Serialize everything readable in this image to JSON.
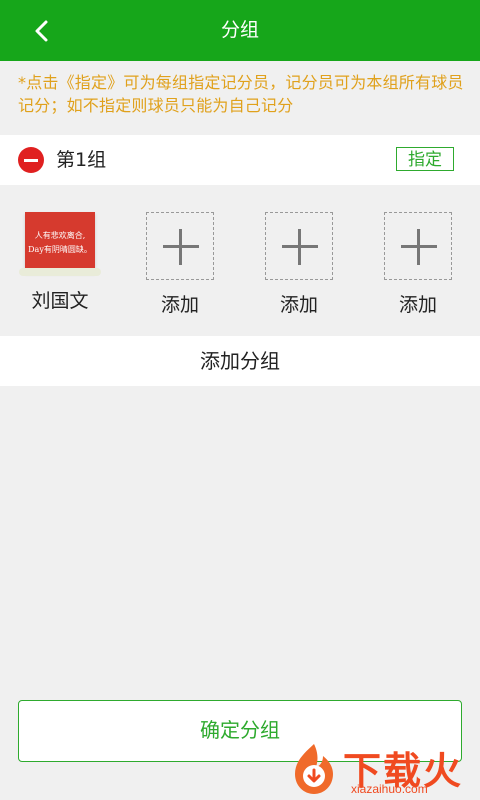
{
  "header": {
    "title": "分组",
    "back_icon": "chevron-left-icon"
  },
  "notice": "*点击《指定》可为每组指定记分员，记分员可为本组所有球员记分；如不指定则球员只能为自己记分",
  "group": {
    "name": "第1组",
    "assign_label": "指定",
    "members": [
      {
        "name": "刘国文",
        "avatar_line1": "人有悲欢离合,",
        "avatar_line2": "Day有阴晴圆缺。"
      },
      {
        "name": "添加"
      },
      {
        "name": "添加"
      },
      {
        "name": "添加"
      }
    ]
  },
  "add_group_label": "添加分组",
  "confirm_label": "确定分组",
  "watermark": {
    "text": "下载火",
    "sub": "xiazaihuo.com"
  },
  "colors": {
    "header_bg": "#16a61a",
    "accent": "#2eaa2e",
    "notice": "#e0a11c",
    "remove": "#e02020"
  }
}
